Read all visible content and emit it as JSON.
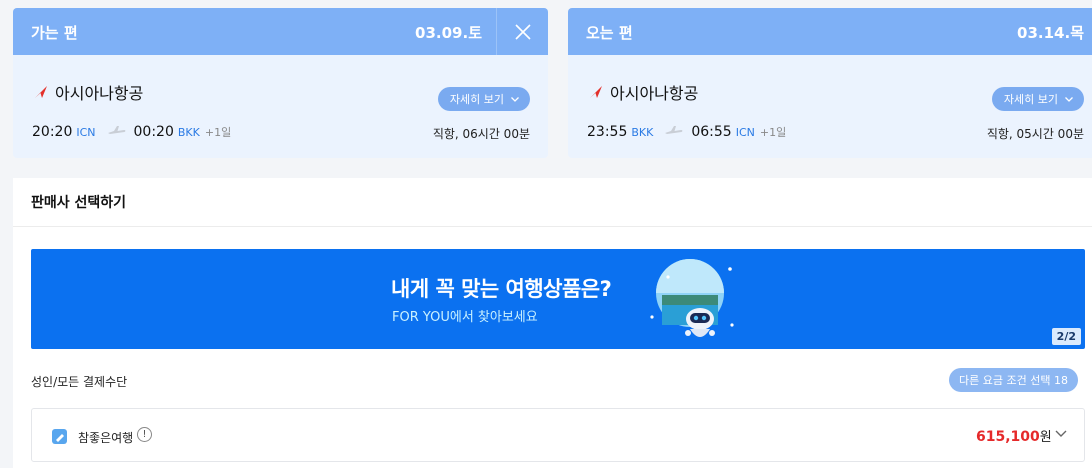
{
  "outbound": {
    "direction": "가는 편",
    "date": "03.09.토",
    "airline": "아시아나항공",
    "detail_label": "자세히 보기",
    "depart_time": "20:20",
    "depart_code": "ICN",
    "arrive_time": "00:20",
    "arrive_code": "BKK",
    "day_offset": "+1일",
    "route_info": "직항, 06시간 00분"
  },
  "inbound": {
    "direction": "오는 편",
    "date": "03.14.목",
    "airline": "아시아나항공",
    "detail_label": "자세히 보기",
    "depart_time": "23:55",
    "depart_code": "BKK",
    "arrive_time": "06:55",
    "arrive_code": "ICN",
    "day_offset": "+1일",
    "route_info": "직항, 05시간 00분"
  },
  "seller_panel": {
    "title": "판매사 선택하기",
    "banner": {
      "title": "내게 꼭 맞는 여행상품은?",
      "subtitle": "FOR YOU에서 찾아보세요",
      "page": "2/2"
    },
    "fare_label": "성인/모든 결제수단",
    "filter_label": "다른 요금 조건 선택 18",
    "sellers": [
      {
        "name": "참좋은여행",
        "price": "615,100",
        "currency": "원"
      }
    ]
  },
  "colors": {
    "header_blue": "#7eb0f6",
    "card_bg": "#ebf3fe",
    "banner_blue": "#0b71f0",
    "price_red": "#e5292a",
    "code_blue": "#2a7ae4"
  }
}
